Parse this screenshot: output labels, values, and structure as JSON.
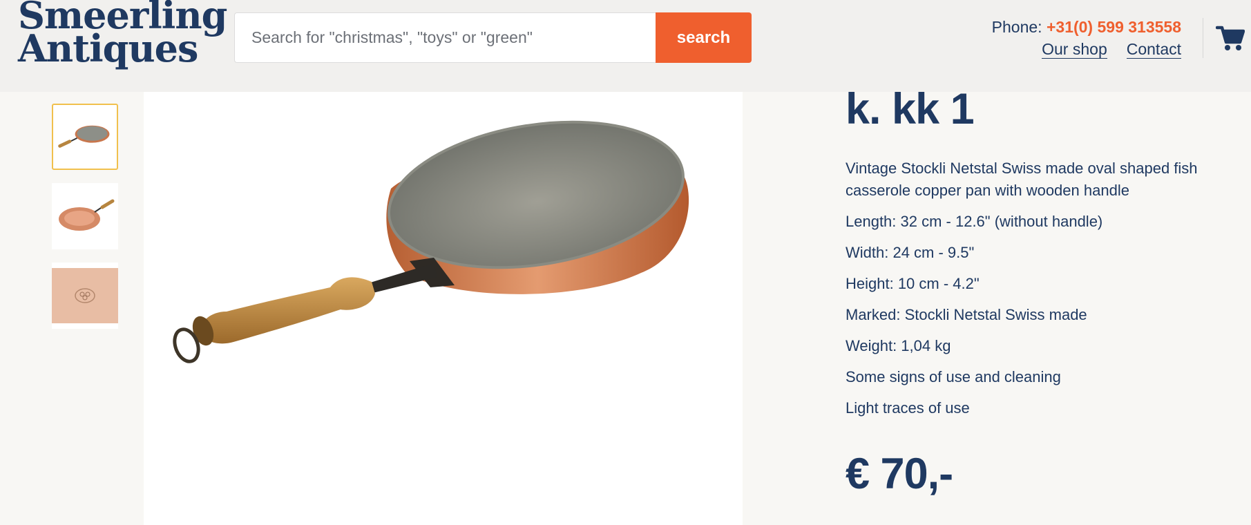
{
  "header": {
    "logo_line1": "Smeerling",
    "logo_line2": "Antiques",
    "search_placeholder": "Search for \"christmas\", \"toys\" or \"green\"",
    "search_button": "search",
    "phone_label": "Phone: ",
    "phone_number": "+31(0) 599 313558",
    "nav": [
      "Our shop",
      "Contact"
    ],
    "cart_icon": "shopping-cart-icon"
  },
  "gallery": {
    "thumbnails": [
      "pan-top-view",
      "pan-bottom-view",
      "maker-mark-closeup"
    ],
    "active_index": 0,
    "main_image": "copper-fish-pan-photo"
  },
  "product": {
    "title": "k. kk 1",
    "details": [
      "Vintage Stockli Netstal Swiss made oval shaped fish casserole copper pan with wooden handle",
      "Length: 32 cm - 12.6\" (without handle)",
      "Width: 24 cm - 9.5\"",
      "Height: 10 cm - 4.2\"",
      "Marked: Stockli Netstal Swiss made",
      "Weight: 1,04 kg",
      "Some signs of use and cleaning",
      "Light traces of use"
    ],
    "price": "€ 70,-"
  },
  "colors": {
    "navy": "#1f3961",
    "accent_orange": "#ef5f2e",
    "header_bg": "#f1f0ee",
    "thumb_active_border": "#f1c04d"
  }
}
